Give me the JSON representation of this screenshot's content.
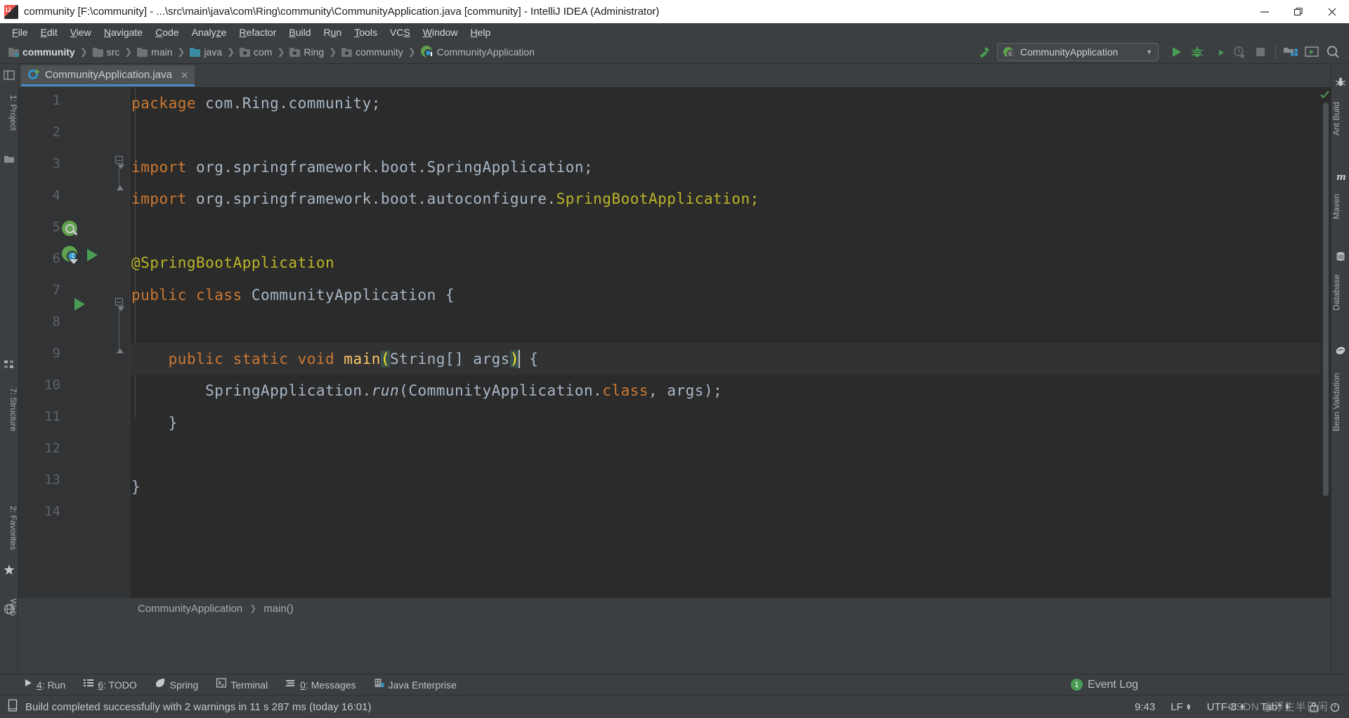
{
  "window": {
    "title": "community [F:\\community] - ...\\src\\main\\java\\com\\Ring\\community\\CommunityApplication.java [community] - IntelliJ IDEA (Administrator)",
    "app_icon": "intellij-idea-icon",
    "minimize_label": "–",
    "restore_label": "❐",
    "close_label": "✕"
  },
  "menubar": {
    "items": [
      {
        "label": "File",
        "mnemonic": "F"
      },
      {
        "label": "Edit",
        "mnemonic": "E"
      },
      {
        "label": "View",
        "mnemonic": "V"
      },
      {
        "label": "Navigate",
        "mnemonic": "N"
      },
      {
        "label": "Code",
        "mnemonic": "C"
      },
      {
        "label": "Analyze",
        "mnemonic": "z"
      },
      {
        "label": "Refactor",
        "mnemonic": "R"
      },
      {
        "label": "Build",
        "mnemonic": "B"
      },
      {
        "label": "Run",
        "mnemonic": "u"
      },
      {
        "label": "Tools",
        "mnemonic": "T"
      },
      {
        "label": "VCS",
        "mnemonic": "S"
      },
      {
        "label": "Window",
        "mnemonic": "W"
      },
      {
        "label": "Help",
        "mnemonic": "H"
      }
    ]
  },
  "breadcrumb": {
    "separator": "❯",
    "items": [
      {
        "label": "community",
        "icon": "module-folder-icon",
        "kind": "module"
      },
      {
        "label": "src",
        "icon": "folder-icon",
        "kind": "folder"
      },
      {
        "label": "main",
        "icon": "folder-icon",
        "kind": "folder"
      },
      {
        "label": "java",
        "icon": "source-folder-icon",
        "kind": "source"
      },
      {
        "label": "com",
        "icon": "package-icon",
        "kind": "package"
      },
      {
        "label": "Ring",
        "icon": "package-icon",
        "kind": "package"
      },
      {
        "label": "community",
        "icon": "package-icon",
        "kind": "package"
      },
      {
        "label": "CommunityApplication",
        "icon": "spring-class-icon",
        "kind": "class"
      }
    ]
  },
  "toolbar": {
    "build_icon": "build-hammer-icon",
    "run_config": {
      "label": "CommunityApplication",
      "icon": "spring-boot-run-config-icon",
      "dropdown_arrow": "▼"
    },
    "buttons": [
      {
        "name": "run-button",
        "icon": "play-icon",
        "enabled": true
      },
      {
        "name": "debug-button",
        "icon": "bug-icon",
        "enabled": true
      },
      {
        "name": "run-with-coverage-button",
        "icon": "coverage-icon",
        "enabled": true
      },
      {
        "name": "profile-button",
        "icon": "profiler-icon",
        "enabled": false
      },
      {
        "name": "stop-button",
        "icon": "stop-square-icon",
        "enabled": false
      },
      {
        "name": "project-structure-button",
        "icon": "project-structure-icon",
        "enabled": true
      },
      {
        "name": "update-project-button",
        "icon": "run-anything-icon",
        "enabled": true
      },
      {
        "name": "search-everywhere-button",
        "icon": "search-icon",
        "enabled": true
      }
    ]
  },
  "editor_tab": {
    "label": "CommunityApplication.java",
    "icon": "spring-boot-class-icon",
    "close_label": "✕"
  },
  "left_strip": {
    "items": [
      {
        "label": "1: Project",
        "icon": "project-icon"
      },
      {
        "label": "7: Structure",
        "icon": "structure-icon"
      },
      {
        "label": "2: Favorites",
        "icon": "star-icon"
      },
      {
        "label": "Web",
        "icon": "web-icon"
      }
    ]
  },
  "right_strip": {
    "items": [
      {
        "label": "Ant Build",
        "icon": "ant-icon"
      },
      {
        "label": "Maven",
        "icon": "maven-m-icon"
      },
      {
        "label": "Database",
        "icon": "database-icon"
      },
      {
        "label": "Bean Validation",
        "icon": "bean-validation-icon"
      }
    ]
  },
  "code": {
    "language": "java",
    "current_line": 9,
    "total_lines": 14,
    "lines": [
      {
        "n": 1,
        "tokens": [
          {
            "t": "package",
            "c": "kw"
          },
          {
            "t": " com.Ring.community;",
            "c": "pl"
          }
        ]
      },
      {
        "n": 2,
        "tokens": []
      },
      {
        "n": 3,
        "tokens": [
          {
            "t": "import",
            "c": "kw"
          },
          {
            "t": " org.springframework.boot.SpringApplication;",
            "c": "pl"
          }
        ],
        "fold": "start"
      },
      {
        "n": 4,
        "tokens": [
          {
            "t": "import",
            "c": "kw"
          },
          {
            "t": " org.springframework.boot.autoconfigure.",
            "c": "pl"
          },
          {
            "t": "SpringBootApplication;",
            "c": "ann"
          }
        ],
        "fold": "end"
      },
      {
        "n": 5,
        "tokens": []
      },
      {
        "n": 6,
        "tokens": [
          {
            "t": "@SpringBootApplication",
            "c": "ann"
          }
        ],
        "gutter": "spring-bean-icon"
      },
      {
        "n": 7,
        "tokens": [
          {
            "t": "public class",
            "c": "kw"
          },
          {
            "t": " CommunityApplication {",
            "c": "pl"
          }
        ],
        "gutter": "spring-boot-run-icon"
      },
      {
        "n": 8,
        "tokens": []
      },
      {
        "n": 9,
        "tokens": [
          {
            "t": "    public static void ",
            "c": "kw"
          },
          {
            "t": "main",
            "c": "meth"
          },
          {
            "t": "(",
            "c": "brk-hl"
          },
          {
            "t": "String[] args",
            "c": "pl"
          },
          {
            "t": ")",
            "c": "brk-hl"
          },
          {
            "t": " {",
            "c": "pl"
          }
        ],
        "gutter": "run-method-icon",
        "fold": "start"
      },
      {
        "n": 10,
        "tokens": [
          {
            "t": "        SpringApplication.",
            "c": "pl"
          },
          {
            "t": "run",
            "c": "pl ital"
          },
          {
            "t": "(CommunityApplication.",
            "c": "pl"
          },
          {
            "t": "class",
            "c": "kw"
          },
          {
            "t": ", args);",
            "c": "pl"
          }
        ]
      },
      {
        "n": 11,
        "tokens": [
          {
            "t": "    }",
            "c": "pl"
          }
        ],
        "fold": "end"
      },
      {
        "n": 12,
        "tokens": []
      },
      {
        "n": 13,
        "tokens": [
          {
            "t": "}",
            "c": "pl"
          }
        ]
      },
      {
        "n": 14,
        "tokens": []
      }
    ],
    "inspection_status": "ok-checkmark"
  },
  "editor_breadcrumb": {
    "separator": "❯",
    "items": [
      "CommunityApplication",
      "main()"
    ]
  },
  "bottom_bar": {
    "items": [
      {
        "label": "4: Run",
        "mnemonic": "4",
        "rest": ": Run",
        "icon": "play-icon"
      },
      {
        "label": "6: TODO",
        "mnemonic": "6",
        "rest": ": TODO",
        "icon": "todo-list-icon"
      },
      {
        "label": "Spring",
        "mnemonic": "",
        "rest": "Spring",
        "icon": "spring-leaf-icon"
      },
      {
        "label": "Terminal",
        "mnemonic": "",
        "rest": "Terminal",
        "icon": "terminal-icon"
      },
      {
        "label": "0: Messages",
        "mnemonic": "0",
        "rest": ": Messages",
        "icon": "messages-icon"
      },
      {
        "label": "Java Enterprise",
        "mnemonic": "",
        "rest": "Java Enterprise",
        "icon": "java-enterprise-icon"
      }
    ],
    "event_log": {
      "label": "Event Log",
      "count": "1",
      "badge_color": "#499c54"
    }
  },
  "status_bar": {
    "icon": "build-status-icon",
    "message": "Build completed successfully with 2 warnings in 11 s 287 ms (today 16:01)",
    "caret_position": "9:43",
    "line_separator": "LF",
    "encoding": "UTF-8",
    "indent": "Tab*",
    "watermark": "CSDN @浮生半日闲"
  },
  "colors": {
    "background": "#3c3f41",
    "editor_background": "#2b2b2b",
    "gutter_background": "#313335",
    "current_line": "#323232",
    "keyword": "#cc7832",
    "plain": "#a9b7c6",
    "annotation": "#bbb529",
    "method": "#ffc66d",
    "accent_tab": "#4a88c7",
    "run_green": "#499c54",
    "title_bar": "#ffffff"
  }
}
